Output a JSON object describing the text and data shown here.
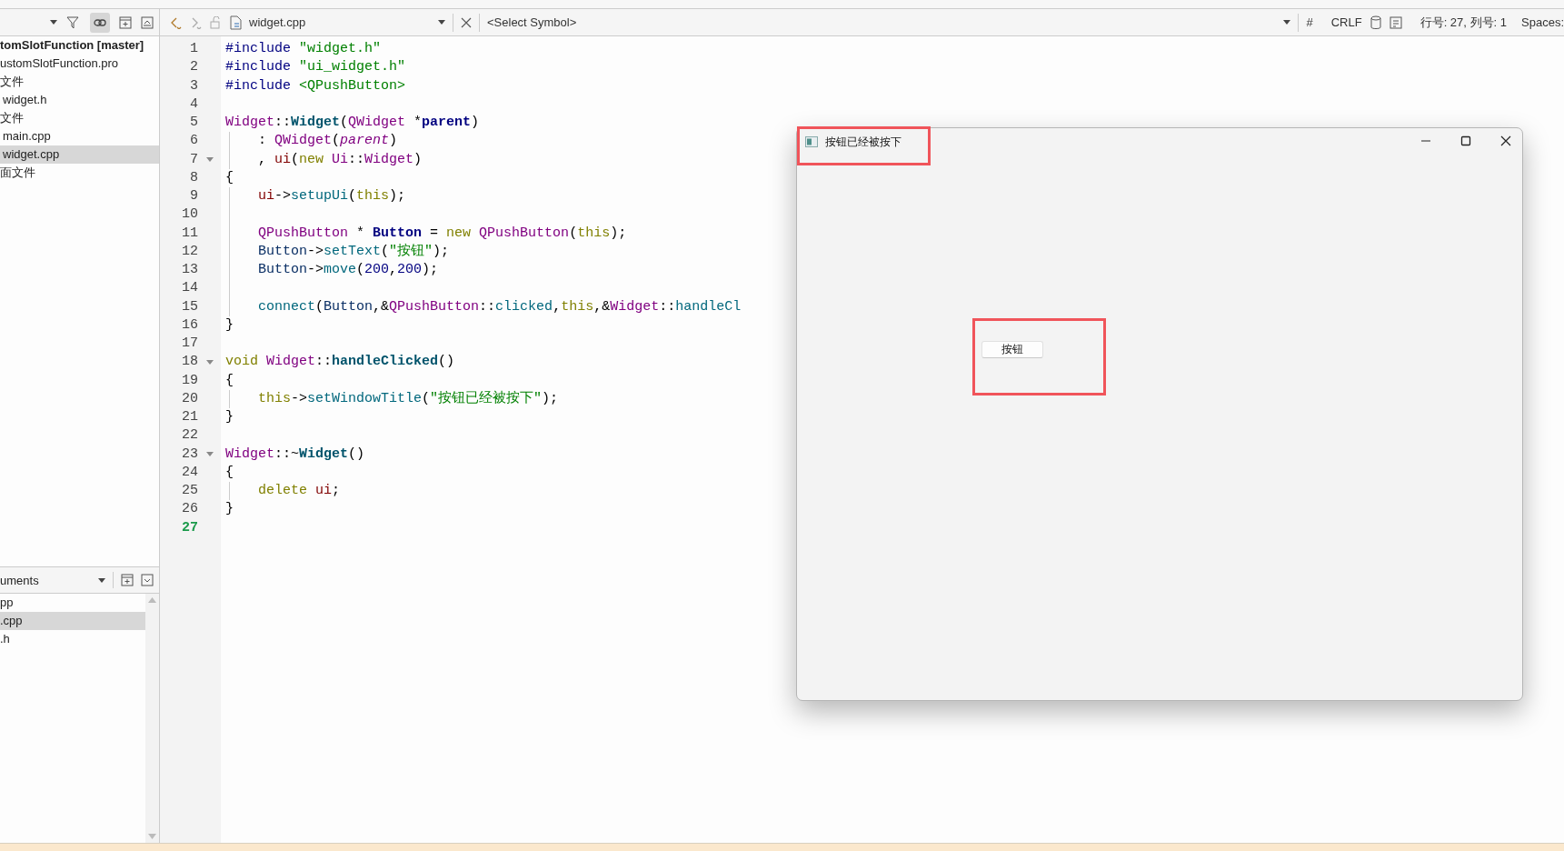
{
  "toolbar": {
    "link_active": true,
    "file_name": "widget.cpp",
    "symbol": "<Select Symbol>",
    "indent_mark": "#",
    "line_ending": "CRLF",
    "cursor_position": "行号: 27, 列号: 1",
    "indentation": "Spaces:"
  },
  "project_tree": {
    "items": [
      {
        "label": "tomSlotFunction [master]",
        "selected": false,
        "children": [
          {
            "label": "ustomSlotFunction.pro",
            "selected": false
          },
          {
            "label": "文件",
            "selected": false,
            "children": [
              {
                "label": "widget.h",
                "selected": false
              }
            ]
          },
          {
            "label": "文件",
            "selected": false,
            "children": [
              {
                "label": "main.cpp",
                "selected": false
              },
              {
                "label": "widget.cpp",
                "selected": true
              }
            ]
          },
          {
            "label": "面文件",
            "selected": false
          }
        ]
      }
    ]
  },
  "open_documents": {
    "title": "uments",
    "items": [
      {
        "label": "pp",
        "selected": false
      },
      {
        "label": ".cpp",
        "selected": true
      },
      {
        "label": ".h",
        "selected": false
      }
    ]
  },
  "editor": {
    "lines": [
      {
        "number": "1",
        "indented": false,
        "fold": false,
        "current": false,
        "tokens": [
          {
            "text": "#include ",
            "kind": "pp"
          },
          {
            "text": "\"widget.h\"",
            "kind": "str"
          }
        ]
      },
      {
        "number": "2",
        "indented": false,
        "fold": false,
        "current": false,
        "tokens": [
          {
            "text": "#include ",
            "kind": "pp"
          },
          {
            "text": "\"ui_widget.h\"",
            "kind": "str"
          }
        ]
      },
      {
        "number": "3",
        "indented": false,
        "fold": false,
        "current": false,
        "tokens": [
          {
            "text": "#include ",
            "kind": "pp"
          },
          {
            "text": "<QPushButton>",
            "kind": "str"
          }
        ]
      },
      {
        "number": "4",
        "indented": false,
        "fold": false,
        "current": false
      },
      {
        "number": "5",
        "indented": false,
        "fold": false,
        "current": false,
        "tokens": [
          {
            "text": "Widget",
            "kind": "type"
          },
          {
            "text": "::",
            "kind": "plain"
          },
          {
            "text": "Widget",
            "kind": "fndef"
          },
          {
            "text": "(",
            "kind": "plain"
          },
          {
            "text": "QWidget",
            "kind": "type"
          },
          {
            "text": " *",
            "kind": "plain"
          },
          {
            "text": "parent",
            "kind": "var"
          },
          {
            "text": ")",
            "kind": "plain"
          }
        ]
      },
      {
        "number": "6",
        "indented": true,
        "fold": false,
        "current": false,
        "tokens": [
          {
            "text": ": ",
            "kind": "plain"
          },
          {
            "text": "QWidget",
            "kind": "type"
          },
          {
            "text": "(",
            "kind": "plain"
          },
          {
            "text": "parent",
            "kind": "param"
          },
          {
            "text": ")",
            "kind": "plain"
          }
        ]
      },
      {
        "number": "7",
        "indented": true,
        "fold": true,
        "current": false,
        "tokens": [
          {
            "text": ", ",
            "kind": "plain"
          },
          {
            "text": "ui",
            "kind": "member"
          },
          {
            "text": "(",
            "kind": "plain"
          },
          {
            "text": "new ",
            "kind": "kw"
          },
          {
            "text": "Ui",
            "kind": "type"
          },
          {
            "text": "::",
            "kind": "plain"
          },
          {
            "text": "Widget",
            "kind": "type"
          },
          {
            "text": ")",
            "kind": "plain"
          }
        ]
      },
      {
        "number": "8",
        "indented": false,
        "fold": false,
        "current": false,
        "tokens": [
          {
            "text": "{",
            "kind": "plain"
          }
        ]
      },
      {
        "number": "9",
        "indented": true,
        "fold": false,
        "current": false,
        "tokens": [
          {
            "text": "ui",
            "kind": "member"
          },
          {
            "text": "->",
            "kind": "plain"
          },
          {
            "text": "setupUi",
            "kind": "fn"
          },
          {
            "text": "(",
            "kind": "plain"
          },
          {
            "text": "this",
            "kind": "kw"
          },
          {
            "text": ");",
            "kind": "plain"
          }
        ]
      },
      {
        "number": "10",
        "indented": true,
        "fold": false,
        "current": false
      },
      {
        "number": "11",
        "indented": true,
        "fold": false,
        "current": false,
        "tokens": [
          {
            "text": "QPushButton",
            "kind": "type"
          },
          {
            "text": " * ",
            "kind": "plain"
          },
          {
            "text": "Button",
            "kind": "var"
          },
          {
            "text": " = ",
            "kind": "plain"
          },
          {
            "text": "new ",
            "kind": "kw"
          },
          {
            "text": "QPushButton",
            "kind": "type"
          },
          {
            "text": "(",
            "kind": "plain"
          },
          {
            "text": "this",
            "kind": "kw"
          },
          {
            "text": ");",
            "kind": "plain"
          }
        ]
      },
      {
        "number": "12",
        "indented": true,
        "fold": false,
        "current": false,
        "tokens": [
          {
            "text": "Button",
            "kind": "local"
          },
          {
            "text": "->",
            "kind": "plain"
          },
          {
            "text": "setText",
            "kind": "fn"
          },
          {
            "text": "(",
            "kind": "plain"
          },
          {
            "text": "\"按钮\"",
            "kind": "str"
          },
          {
            "text": ");",
            "kind": "plain"
          }
        ]
      },
      {
        "number": "13",
        "indented": true,
        "fold": false,
        "current": false,
        "tokens": [
          {
            "text": "Button",
            "kind": "local"
          },
          {
            "text": "->",
            "kind": "plain"
          },
          {
            "text": "move",
            "kind": "fn"
          },
          {
            "text": "(",
            "kind": "plain"
          },
          {
            "text": "200",
            "kind": "num"
          },
          {
            "text": ",",
            "kind": "plain"
          },
          {
            "text": "200",
            "kind": "num"
          },
          {
            "text": ");",
            "kind": "plain"
          }
        ]
      },
      {
        "number": "14",
        "indented": true,
        "fold": false,
        "current": false
      },
      {
        "number": "15",
        "indented": true,
        "fold": false,
        "current": false,
        "tokens": [
          {
            "text": "connect",
            "kind": "fn"
          },
          {
            "text": "(",
            "kind": "plain"
          },
          {
            "text": "Button",
            "kind": "local"
          },
          {
            "text": ",&",
            "kind": "plain"
          },
          {
            "text": "QPushButton",
            "kind": "type"
          },
          {
            "text": "::",
            "kind": "plain"
          },
          {
            "text": "clicked",
            "kind": "fn"
          },
          {
            "text": ",",
            "kind": "plain"
          },
          {
            "text": "this",
            "kind": "kw"
          },
          {
            "text": ",&",
            "kind": "plain"
          },
          {
            "text": "Widget",
            "kind": "type"
          },
          {
            "text": "::",
            "kind": "plain"
          },
          {
            "text": "handleCl",
            "kind": "fn"
          }
        ]
      },
      {
        "number": "16",
        "indented": false,
        "fold": false,
        "current": false,
        "tokens": [
          {
            "text": "}",
            "kind": "plain"
          }
        ]
      },
      {
        "number": "17",
        "indented": false,
        "fold": false,
        "current": false
      },
      {
        "number": "18",
        "indented": false,
        "fold": true,
        "current": false,
        "tokens": [
          {
            "text": "void ",
            "kind": "kw"
          },
          {
            "text": "Widget",
            "kind": "type"
          },
          {
            "text": "::",
            "kind": "plain"
          },
          {
            "text": "handleClicked",
            "kind": "fndef"
          },
          {
            "text": "()",
            "kind": "plain"
          }
        ]
      },
      {
        "number": "19",
        "indented": false,
        "fold": false,
        "current": false,
        "tokens": [
          {
            "text": "{",
            "kind": "plain"
          }
        ]
      },
      {
        "number": "20",
        "indented": true,
        "fold": false,
        "current": false,
        "tokens": [
          {
            "text": "this",
            "kind": "kw"
          },
          {
            "text": "->",
            "kind": "plain"
          },
          {
            "text": "setWindowTitle",
            "kind": "fn"
          },
          {
            "text": "(",
            "kind": "plain"
          },
          {
            "text": "\"按钮已经被按下\"",
            "kind": "str"
          },
          {
            "text": ");",
            "kind": "plain"
          }
        ]
      },
      {
        "number": "21",
        "indented": false,
        "fold": false,
        "current": false,
        "tokens": [
          {
            "text": "}",
            "kind": "plain"
          }
        ]
      },
      {
        "number": "22",
        "indented": false,
        "fold": false,
        "current": false
      },
      {
        "number": "23",
        "indented": false,
        "fold": true,
        "current": false,
        "tokens": [
          {
            "text": "Widget",
            "kind": "type"
          },
          {
            "text": "::~",
            "kind": "plain"
          },
          {
            "text": "Widget",
            "kind": "fndef"
          },
          {
            "text": "()",
            "kind": "plain"
          }
        ]
      },
      {
        "number": "24",
        "indented": false,
        "fold": false,
        "current": false,
        "tokens": [
          {
            "text": "{",
            "kind": "plain"
          }
        ]
      },
      {
        "number": "25",
        "indented": true,
        "fold": false,
        "current": false,
        "tokens": [
          {
            "text": "delete ",
            "kind": "kw"
          },
          {
            "text": "ui",
            "kind": "member"
          },
          {
            "text": ";",
            "kind": "plain"
          }
        ]
      },
      {
        "number": "26",
        "indented": false,
        "fold": false,
        "current": false,
        "tokens": [
          {
            "text": "}",
            "kind": "plain"
          }
        ]
      },
      {
        "number": "27",
        "indented": false,
        "fold": false,
        "current": true
      }
    ]
  },
  "app_window": {
    "title": "按钮已经被按下",
    "title_highlighted": true,
    "button": {
      "label": "按钮",
      "highlighted": true
    }
  }
}
